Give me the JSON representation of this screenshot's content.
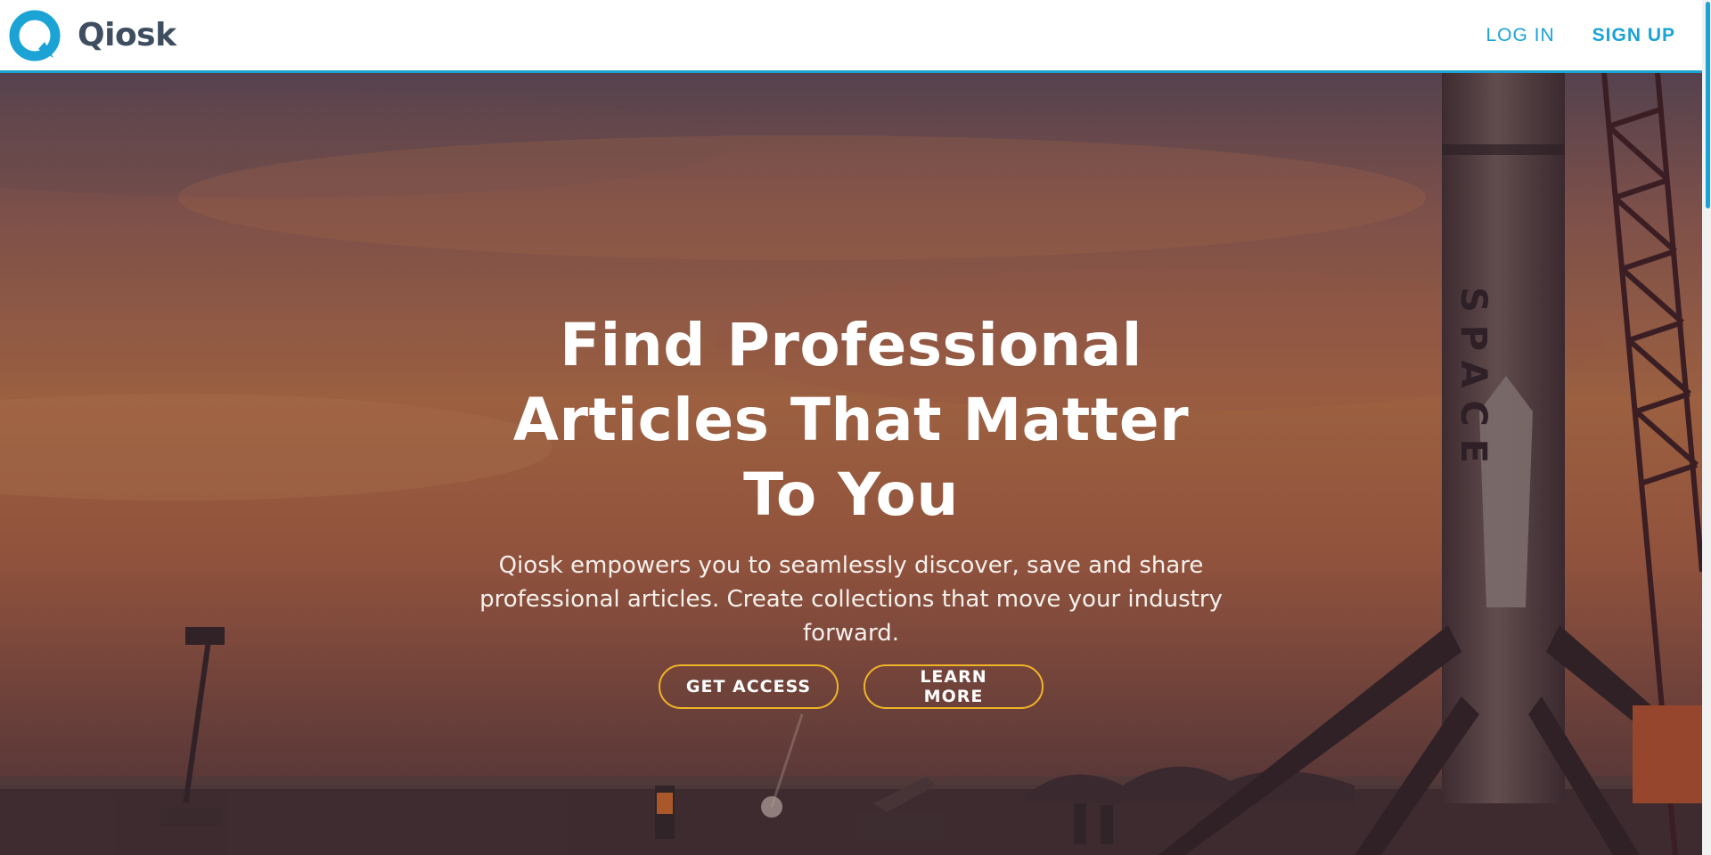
{
  "header": {
    "brand": "Qiosk",
    "nav": {
      "login": "LOG IN",
      "signup": "SIGN UP"
    }
  },
  "hero": {
    "headline": "Find Professional Articles That Matter To You",
    "subtext": "Qiosk empowers you to seamlessly discover, save and share professional articles. Create collections that move your industry forward.",
    "buttons": {
      "primary": "GET ACCESS",
      "secondary": "LEARN MORE"
    },
    "rocket_text": "SPACE"
  },
  "colors": {
    "accent": "#1aa3d4",
    "brand_text": "#3e4e60",
    "button_border": "#f0b428",
    "hero_text": "#ffffff"
  },
  "icons": {
    "logo": "q-logo-icon"
  }
}
